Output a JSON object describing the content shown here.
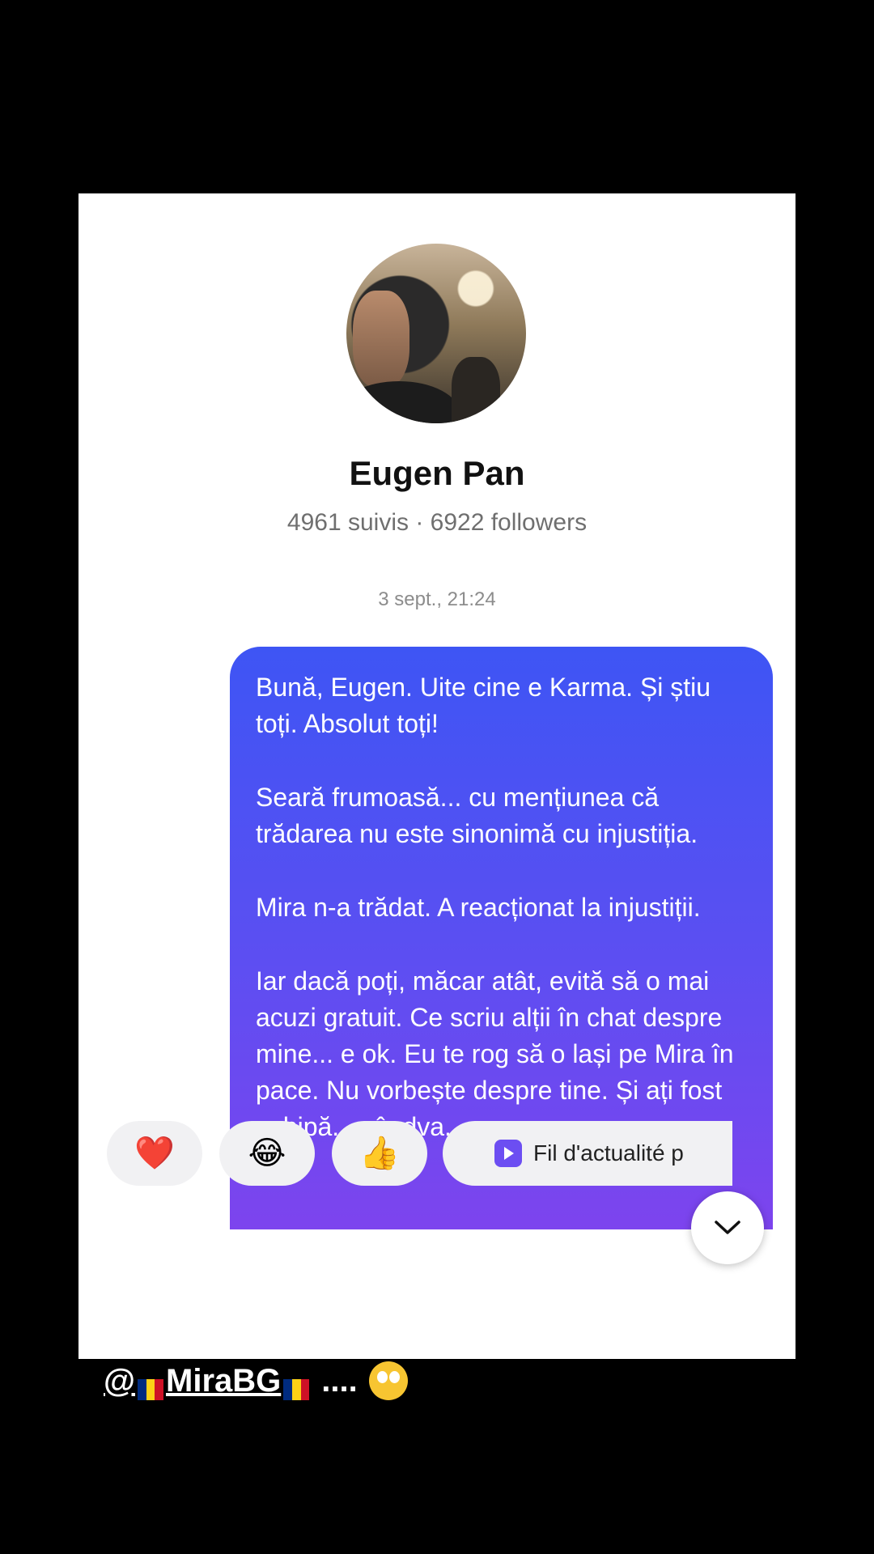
{
  "profile": {
    "name": "Eugen Pan",
    "stats": "4961 suivis · 6922 followers"
  },
  "conversation": {
    "timestamp": "3 sept., 21:24",
    "message_paragraphs": [
      "Bună, Eugen. Uite cine e Karma. Și știu toți. Absolut toți!",
      "Seară frumoasă... cu mențiunea că trădarea nu este sinonimă cu injustiția.",
      "Mira n-a trădat. A reacționat la injustiții.",
      "Iar dacă poți, măcar atât, evită să o mai acuzi gratuit. Ce scriu alții în chat despre mine... e ok. Eu te rog să o lași pe Mira în pace. Nu vorbește despre tine. Și ați fost echipă... cândva."
    ]
  },
  "reactions": {
    "heart": "❤️",
    "laugh": "😂",
    "thumbs_up": "👍",
    "point": "👆",
    "feed_label": "Fil d'actualité p"
  },
  "overlay_caption": {
    "at": "@",
    "handle": "MiraBG",
    "dots": "....",
    "emoji_name": "eye-roll-emoji"
  },
  "colors": {
    "bubble_top": "#3e55f4",
    "bubble_bottom": "#7d44ee",
    "flag_blue": "#002b7f",
    "flag_yellow": "#fcd116",
    "flag_red": "#ce1126"
  }
}
